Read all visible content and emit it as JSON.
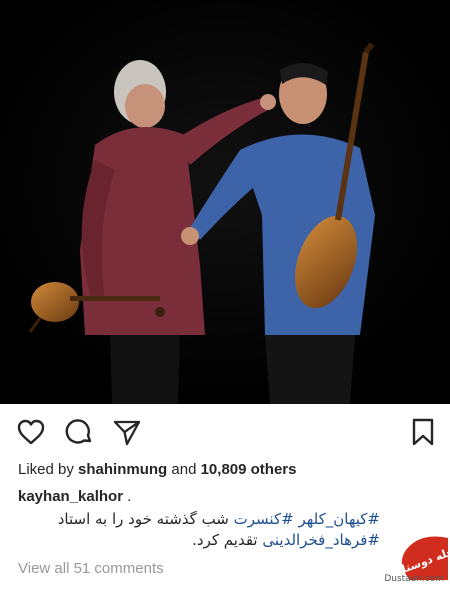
{
  "post": {
    "likes": {
      "prefix": "Liked by",
      "user": "shahinmung",
      "connector": "and",
      "count": "10,809 others"
    },
    "username": "kayhan_kalhor",
    "username_suffix": ".",
    "caption": {
      "tag1": "#کیهان_کلهر",
      "tag2": "#کنسرت",
      "text1": "شب گذشته خود را به استاد",
      "tag3": "#فرهاد_فخرالدینی",
      "text2": "تقدیم کرد."
    },
    "comments_link": "View all 51 comments"
  },
  "actions": {
    "like_icon": "heart-outline",
    "comment_icon": "speech-bubble",
    "share_icon": "paper-plane",
    "save_icon": "bookmark"
  },
  "watermark": {
    "logo_text": "مجله دوستان",
    "site": "Dustaan.com"
  },
  "colors": {
    "hashtag": "#1d4f91",
    "muted": "#999999",
    "text": "#262626"
  }
}
